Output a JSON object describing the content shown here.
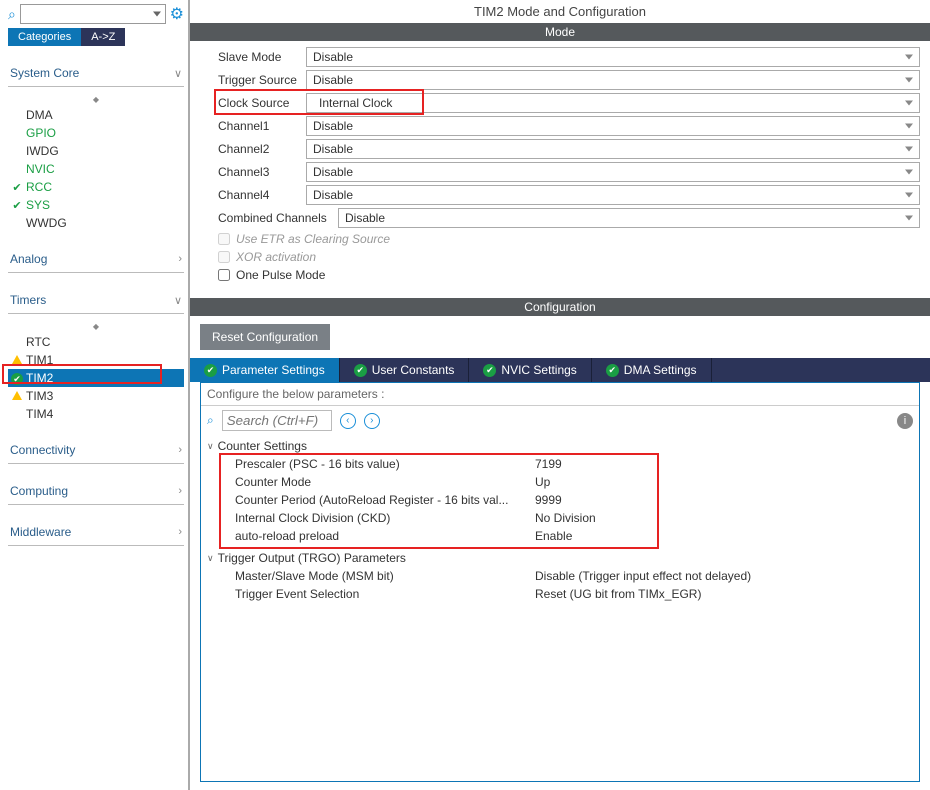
{
  "sidebar": {
    "search_value": "",
    "tabs": {
      "categories": "Categories",
      "az": "A->Z"
    },
    "groups": [
      {
        "name": "System Core",
        "expanded": true,
        "items": [
          {
            "label": "DMA"
          },
          {
            "label": "GPIO",
            "green": true
          },
          {
            "label": "IWDG"
          },
          {
            "label": "NVIC",
            "green": true
          },
          {
            "label": "RCC",
            "green": true,
            "check": true
          },
          {
            "label": "SYS",
            "green": true,
            "check": true
          },
          {
            "label": "WWDG"
          }
        ]
      },
      {
        "name": "Analog",
        "expanded": false,
        "chev": ">"
      },
      {
        "name": "Timers",
        "expanded": true,
        "items": [
          {
            "label": "RTC"
          },
          {
            "label": "TIM1",
            "warn": true
          },
          {
            "label": "TIM2",
            "selected": true,
            "okcircle": true
          },
          {
            "label": "TIM3",
            "warn": true
          },
          {
            "label": "TIM4"
          }
        ]
      },
      {
        "name": "Connectivity",
        "expanded": false,
        "chev": ">"
      },
      {
        "name": "Computing",
        "expanded": false,
        "chev": ">"
      },
      {
        "name": "Middleware",
        "expanded": false,
        "chev": ">"
      }
    ]
  },
  "title": "TIM2 Mode and Configuration",
  "mode": {
    "header": "Mode",
    "rows": [
      {
        "label": "Slave Mode",
        "value": "Disable"
      },
      {
        "label": "Trigger Source",
        "value": "Disable"
      },
      {
        "label": "Clock Source",
        "value": "Internal Clock",
        "highlight": true
      },
      {
        "label": "Channel1",
        "value": "Disable"
      },
      {
        "label": "Channel2",
        "value": "Disable"
      },
      {
        "label": "Channel3",
        "value": "Disable"
      },
      {
        "label": "Channel4",
        "value": "Disable"
      },
      {
        "label": "Combined Channels",
        "value": "Disable",
        "wide": true
      }
    ],
    "checks": [
      {
        "label": "Use ETR as Clearing Source",
        "disabled": true
      },
      {
        "label": "XOR activation",
        "disabled": true
      },
      {
        "label": "One Pulse Mode",
        "disabled": false
      }
    ]
  },
  "config": {
    "header": "Configuration",
    "reset_btn": "Reset Configuration",
    "tabs": [
      "Parameter Settings",
      "User Constants",
      "NVIC Settings",
      "DMA Settings"
    ],
    "hint": "Configure the below parameters :",
    "search_placeholder": "Search (Ctrl+F)",
    "groups": [
      {
        "name": "Counter Settings",
        "params": [
          {
            "name": "Prescaler (PSC - 16 bits value)",
            "value": "7199"
          },
          {
            "name": "Counter Mode",
            "value": "Up"
          },
          {
            "name": "Counter Period (AutoReload Register - 16 bits val...",
            "value": "9999"
          },
          {
            "name": "Internal Clock Division (CKD)",
            "value": "No Division"
          },
          {
            "name": "auto-reload preload",
            "value": "Enable"
          }
        ],
        "highlight": true
      },
      {
        "name": "Trigger Output (TRGO) Parameters",
        "params": [
          {
            "name": "Master/Slave Mode (MSM bit)",
            "value": "Disable (Trigger input effect not delayed)"
          },
          {
            "name": "Trigger Event Selection",
            "value": "Reset (UG bit from TIMx_EGR)"
          }
        ]
      }
    ]
  }
}
